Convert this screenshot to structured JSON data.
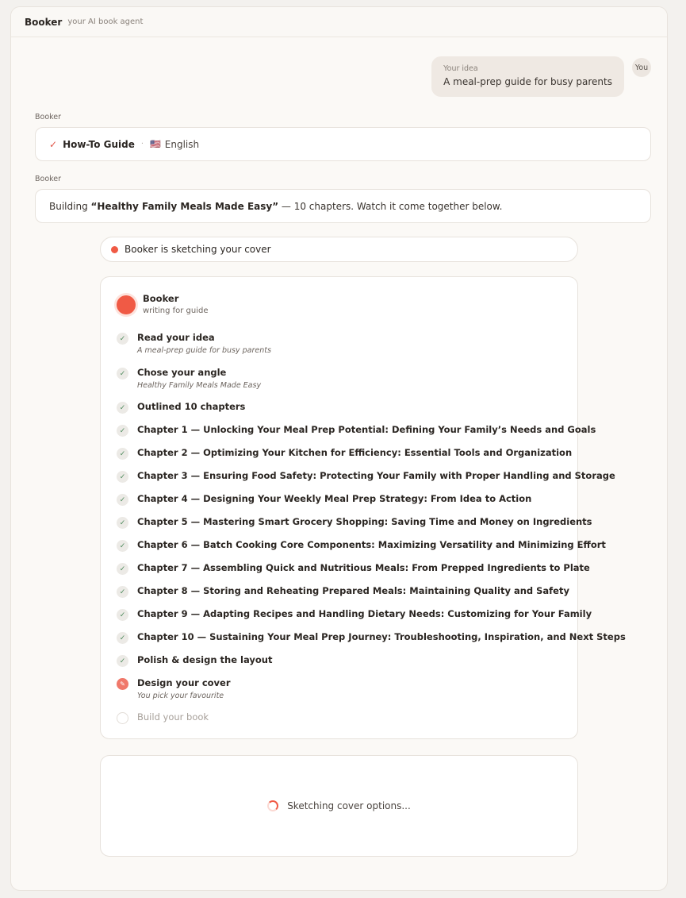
{
  "app": {
    "title": "Booker",
    "subtitle": "your AI book agent"
  },
  "user_message": {
    "label": "Your idea",
    "text": "A meal-prep guide for busy parents",
    "avatar": "You"
  },
  "booker_messages": [
    {
      "sender": "Booker",
      "format": "How-To Guide",
      "separator": "·",
      "flag": "🇺🇸",
      "language": "English"
    },
    {
      "sender": "Booker",
      "prefix": "Building ",
      "book_title": "“Healthy Family Meals Made Easy”",
      "suffix": " — 10 chapters. Watch it come together below."
    }
  ],
  "status": {
    "text": "Booker is sketching your cover",
    "color": "#f05a45"
  },
  "agent": {
    "name": "Booker",
    "subtitle": "writing for guide"
  },
  "steps": [
    {
      "title": "Read your idea",
      "subtitle": "A meal-prep guide for busy parents",
      "state": "done",
      "icon": "check-icon"
    },
    {
      "title": "Chose your angle",
      "subtitle": "Healthy Family Meals Made Easy",
      "state": "done",
      "icon": "check-icon"
    },
    {
      "title": "Outlined 10 chapters",
      "state": "done",
      "icon": "check-icon"
    },
    {
      "title": "Chapter 1 — Unlocking Your Meal Prep Potential: Defining Your Family’s Needs and Goals",
      "state": "done",
      "icon": "check-icon"
    },
    {
      "title": "Chapter 2 — Optimizing Your Kitchen for Efficiency: Essential Tools and Organization",
      "state": "done",
      "icon": "check-icon"
    },
    {
      "title": "Chapter 3 — Ensuring Food Safety: Protecting Your Family with Proper Handling and Storage",
      "state": "done",
      "icon": "check-icon"
    },
    {
      "title": "Chapter 4 — Designing Your Weekly Meal Prep Strategy: From Idea to Action",
      "state": "done",
      "icon": "check-icon"
    },
    {
      "title": "Chapter 5 — Mastering Smart Grocery Shopping: Saving Time and Money on Ingredients",
      "state": "done",
      "icon": "check-icon"
    },
    {
      "title": "Chapter 6 — Batch Cooking Core Components: Maximizing Versatility and Minimizing Effort",
      "state": "done",
      "icon": "check-icon"
    },
    {
      "title": "Chapter 7 — Assembling Quick and Nutritious Meals: From Prepped Ingredients to Plate",
      "state": "done",
      "icon": "check-icon"
    },
    {
      "title": "Chapter 8 — Storing and Reheating Prepared Meals: Maintaining Quality and Safety",
      "state": "done",
      "icon": "check-icon"
    },
    {
      "title": "Chapter 9 — Adapting Recipes and Handling Dietary Needs: Customizing for Your Family",
      "state": "done",
      "icon": "check-icon"
    },
    {
      "title": "Chapter 10 — Sustaining Your Meal Prep Journey: Troubleshooting, Inspiration, and Next Steps",
      "state": "done",
      "icon": "check-icon"
    },
    {
      "title": "Polish & design the layout",
      "state": "done",
      "icon": "check-icon"
    },
    {
      "title": "Design your cover",
      "subtitle": "You pick your favourite",
      "state": "active",
      "icon": "brush-icon"
    },
    {
      "title": "Build your book",
      "state": "pending",
      "icon": "empty-circle-icon"
    }
  ],
  "cover_loading": {
    "text": "Sketching cover options..."
  },
  "colors": {
    "accent": "#f05a45",
    "check": "#4d8a5c",
    "background": "#fbf9f6"
  }
}
